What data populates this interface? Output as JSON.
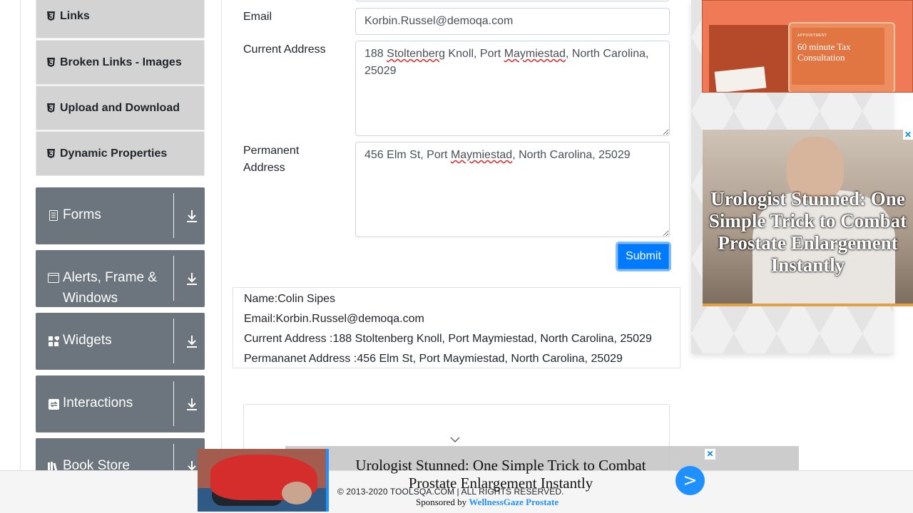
{
  "sidebar": {
    "sub_items": [
      {
        "label": "Links",
        "icon": "html5-icon"
      },
      {
        "label": "Broken Links - Images",
        "icon": "html5-icon"
      },
      {
        "label": "Upload and Download",
        "icon": "html5-icon"
      },
      {
        "label": "Dynamic Properties",
        "icon": "html5-icon"
      }
    ],
    "groups": [
      {
        "label": "Forms",
        "icon": "document-icon"
      },
      {
        "label": "Alerts, Frame & Windows",
        "icon": "window-icon"
      },
      {
        "label": "Widgets",
        "icon": "widgets-icon"
      },
      {
        "label": "Interactions",
        "icon": "interactions-icon"
      },
      {
        "label": "Book Store",
        "icon": "books-icon"
      }
    ]
  },
  "form": {
    "email_label": "Email",
    "email_value": "Korbin.Russel@demoqa.com",
    "current_address_label": "Current Address",
    "current_address_value_parts": [
      "188 ",
      "Stoltenberg",
      " Knoll, Port ",
      "Maymiestad",
      ", North Carolina, 25029"
    ],
    "permanent_address_label": "Permanent Address",
    "permanent_address_value_parts": [
      "456 Elm St, Port ",
      "Maymiestad",
      ", North Carolina, 25029"
    ],
    "submit_label": "Submit"
  },
  "output": {
    "name": "Name:Colin Sipes",
    "email": "Email:Korbin.Russel@demoqa.com",
    "current_address": "Current Address :188 Stoltenberg Knoll, Port Maymiestad, North Carolina, 25029",
    "permanent_address": "Permananet Address :456 Elm St, Port Maymiestad, North Carolina, 25029"
  },
  "ads": {
    "top_card_small": "APPOINTMENT",
    "top_card_title": "60 minute Tax Consultation",
    "mid_headline": "Urologist Stunned: One Simple Trick to Combat Prostate Enlargement Instantly",
    "close_glyph": "✕",
    "banner_headline": "Urologist Stunned: One Simple Trick to Combat Prostate Enlargement Instantly",
    "banner_sponsor_prefix": "Sponsored by",
    "banner_sponsor_brand": "WellnessGaze Prostate",
    "banner_go": ">"
  },
  "footer": {
    "text": "© 2013-2020 TOOLSQA.COM | ALL RIGHTS RESERVED."
  },
  "colors": {
    "accent": "#007bff",
    "sidebar_group": "#6c757d",
    "sidebar_sub": "#d3d3d3"
  }
}
